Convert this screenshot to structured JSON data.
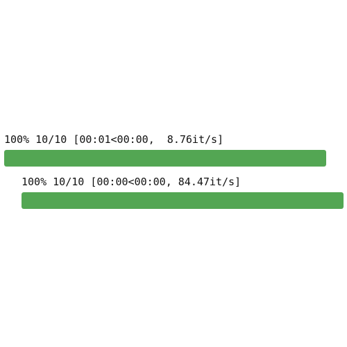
{
  "progress_bars": [
    {
      "status_text": "100% 10/10 [00:01<00:00,  8.76it/s]",
      "percent": 100,
      "completed": 10,
      "total": 10,
      "elapsed": "00:01",
      "remaining": "00:00",
      "rate": "8.76it/s"
    },
    {
      "status_text": "100% 10/10 [00:00<00:00, 84.47it/s]",
      "percent": 100,
      "completed": 10,
      "total": 10,
      "elapsed": "00:00",
      "remaining": "00:00",
      "rate": "84.47it/s"
    }
  ],
  "colors": {
    "fill": "#53a653",
    "track": "#e0e0e0",
    "text": "#111111",
    "background": "#ffffff"
  }
}
